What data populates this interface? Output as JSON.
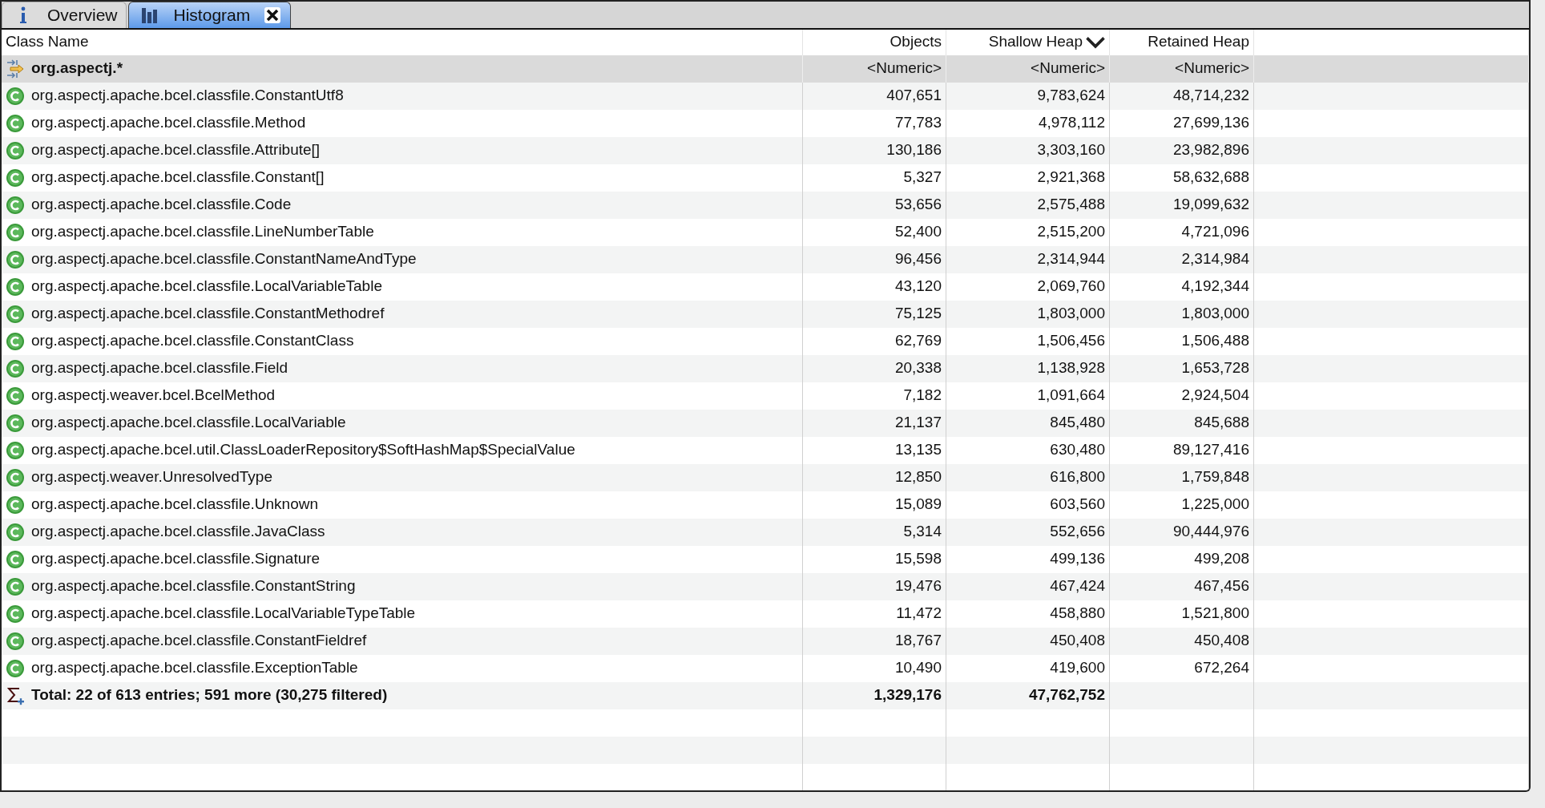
{
  "tabs": [
    {
      "label": "Overview",
      "selected": false,
      "closable": false
    },
    {
      "label": "Histogram",
      "selected": true,
      "closable": true
    }
  ],
  "table": {
    "columns": [
      {
        "label": "Class Name",
        "sorted": false
      },
      {
        "label": "Objects",
        "sorted": false
      },
      {
        "label": "Shallow Heap",
        "sorted": true
      },
      {
        "label": "Retained Heap",
        "sorted": false
      }
    ],
    "filter_row": {
      "name": "org.aspectj.*",
      "objects": "<Numeric>",
      "shallow_heap": "<Numeric>",
      "retained_heap": "<Numeric>"
    },
    "rows": [
      {
        "name": "org.aspectj.apache.bcel.classfile.ConstantUtf8",
        "objects": "407,651",
        "shallow_heap": "9,783,624",
        "retained_heap": "48,714,232"
      },
      {
        "name": "org.aspectj.apache.bcel.classfile.Method",
        "objects": "77,783",
        "shallow_heap": "4,978,112",
        "retained_heap": "27,699,136"
      },
      {
        "name": "org.aspectj.apache.bcel.classfile.Attribute[]",
        "objects": "130,186",
        "shallow_heap": "3,303,160",
        "retained_heap": "23,982,896"
      },
      {
        "name": "org.aspectj.apache.bcel.classfile.Constant[]",
        "objects": "5,327",
        "shallow_heap": "2,921,368",
        "retained_heap": "58,632,688"
      },
      {
        "name": "org.aspectj.apache.bcel.classfile.Code",
        "objects": "53,656",
        "shallow_heap": "2,575,488",
        "retained_heap": "19,099,632"
      },
      {
        "name": "org.aspectj.apache.bcel.classfile.LineNumberTable",
        "objects": "52,400",
        "shallow_heap": "2,515,200",
        "retained_heap": "4,721,096"
      },
      {
        "name": "org.aspectj.apache.bcel.classfile.ConstantNameAndType",
        "objects": "96,456",
        "shallow_heap": "2,314,944",
        "retained_heap": "2,314,984"
      },
      {
        "name": "org.aspectj.apache.bcel.classfile.LocalVariableTable",
        "objects": "43,120",
        "shallow_heap": "2,069,760",
        "retained_heap": "4,192,344"
      },
      {
        "name": "org.aspectj.apache.bcel.classfile.ConstantMethodref",
        "objects": "75,125",
        "shallow_heap": "1,803,000",
        "retained_heap": "1,803,000"
      },
      {
        "name": "org.aspectj.apache.bcel.classfile.ConstantClass",
        "objects": "62,769",
        "shallow_heap": "1,506,456",
        "retained_heap": "1,506,488"
      },
      {
        "name": "org.aspectj.apache.bcel.classfile.Field",
        "objects": "20,338",
        "shallow_heap": "1,138,928",
        "retained_heap": "1,653,728"
      },
      {
        "name": "org.aspectj.weaver.bcel.BcelMethod",
        "objects": "7,182",
        "shallow_heap": "1,091,664",
        "retained_heap": "2,924,504"
      },
      {
        "name": "org.aspectj.apache.bcel.classfile.LocalVariable",
        "objects": "21,137",
        "shallow_heap": "845,480",
        "retained_heap": "845,688"
      },
      {
        "name": "org.aspectj.apache.bcel.util.ClassLoaderRepository$SoftHashMap$SpecialValue",
        "objects": "13,135",
        "shallow_heap": "630,480",
        "retained_heap": "89,127,416"
      },
      {
        "name": "org.aspectj.weaver.UnresolvedType",
        "objects": "12,850",
        "shallow_heap": "616,800",
        "retained_heap": "1,759,848"
      },
      {
        "name": "org.aspectj.apache.bcel.classfile.Unknown",
        "objects": "15,089",
        "shallow_heap": "603,560",
        "retained_heap": "1,225,000"
      },
      {
        "name": "org.aspectj.apache.bcel.classfile.JavaClass",
        "objects": "5,314",
        "shallow_heap": "552,656",
        "retained_heap": "90,444,976"
      },
      {
        "name": "org.aspectj.apache.bcel.classfile.Signature",
        "objects": "15,598",
        "shallow_heap": "499,136",
        "retained_heap": "499,208"
      },
      {
        "name": "org.aspectj.apache.bcel.classfile.ConstantString",
        "objects": "19,476",
        "shallow_heap": "467,424",
        "retained_heap": "467,456"
      },
      {
        "name": "org.aspectj.apache.bcel.classfile.LocalVariableTypeTable",
        "objects": "11,472",
        "shallow_heap": "458,880",
        "retained_heap": "1,521,800"
      },
      {
        "name": "org.aspectj.apache.bcel.classfile.ConstantFieldref",
        "objects": "18,767",
        "shallow_heap": "450,408",
        "retained_heap": "450,408"
      },
      {
        "name": "org.aspectj.apache.bcel.classfile.ExceptionTable",
        "objects": "10,490",
        "shallow_heap": "419,600",
        "retained_heap": "672,264"
      }
    ],
    "total_row": {
      "name": "Total: 22 of 613 entries; 591 more (30,275 filtered)",
      "objects": "1,329,176",
      "shallow_heap": "47,762,752"
    }
  }
}
